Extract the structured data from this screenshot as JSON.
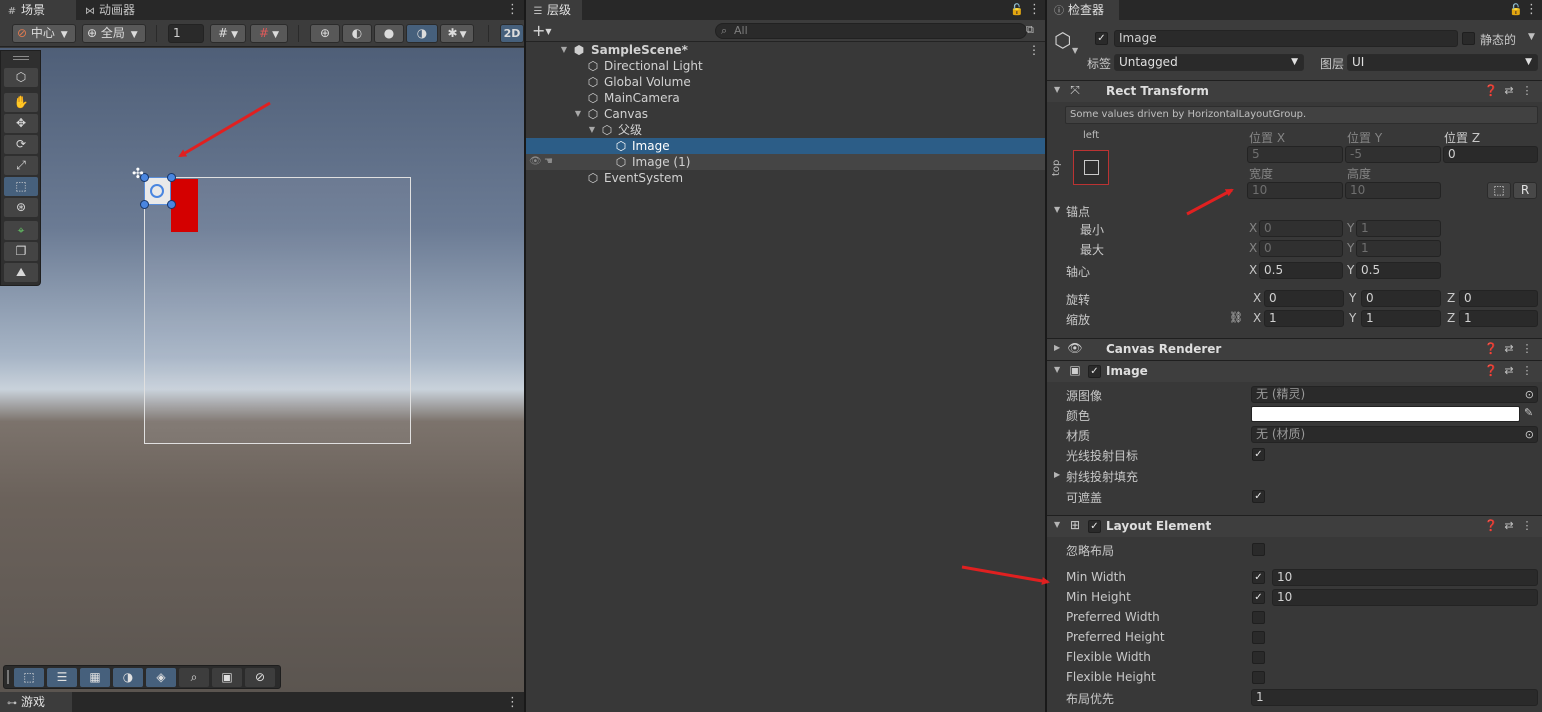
{
  "scene_panel": {
    "tab_scene": "场景",
    "tab_animator": "动画器",
    "pivot_mode": "中心",
    "space_mode": "全局",
    "grid_size": "1",
    "btn_2d": "2D"
  },
  "hierarchy": {
    "tab_label": "层级",
    "search_placeholder": "All",
    "items": [
      {
        "label": "SampleScene*"
      },
      {
        "label": "Directional Light"
      },
      {
        "label": "Global Volume"
      },
      {
        "label": "MainCamera"
      },
      {
        "label": "Canvas"
      },
      {
        "label": "父级"
      },
      {
        "label": "Image"
      },
      {
        "label": "Image (1)"
      },
      {
        "label": "EventSystem"
      }
    ]
  },
  "game_panel": {
    "tab_label": "游戏"
  },
  "inspector": {
    "tab_label": "检查器",
    "object_name": "Image",
    "static_label": "静态的",
    "tag_label": "标签",
    "tag_value": "Untagged",
    "layer_label": "图层",
    "layer_value": "UI",
    "rect_transform": {
      "title": "Rect Transform",
      "info": "Some values driven by HorizontalLayoutGroup.",
      "anchor_h": "left",
      "anchor_v": "top",
      "pos_x_label": "位置 X",
      "pos_y_label": "位置 Y",
      "pos_z_label": "位置 Z",
      "pos_x": "5",
      "pos_y": "-5",
      "pos_z": "0",
      "width_label": "宽度",
      "height_label": "高度",
      "width": "10",
      "height": "10",
      "r_button": "R",
      "anchors_label": "锚点",
      "min_label": "最小",
      "max_label": "最大",
      "anchor_min_x": "0",
      "anchor_min_y": "1",
      "anchor_max_x": "0",
      "anchor_max_y": "1",
      "pivot_label": "轴心",
      "pivot_x": "0.5",
      "pivot_y": "0.5",
      "rotation_label": "旋转",
      "rot_x": "0",
      "rot_y": "0",
      "rot_z": "0",
      "scale_label": "缩放",
      "scale_x": "1",
      "scale_y": "1",
      "scale_z": "1",
      "x": "X",
      "y": "Y",
      "z": "Z"
    },
    "canvas_renderer": {
      "title": "Canvas Renderer"
    },
    "image": {
      "title": "Image",
      "source_label": "源图像",
      "source_value": "无 (精灵)",
      "color_label": "颜色",
      "color_value": "#ffffff",
      "material_label": "材质",
      "material_value": "无 (材质)",
      "raycast_label": "光线投射目标",
      "raycast_padding_label": "射线投射填充",
      "maskable_label": "可遮盖"
    },
    "layout_element": {
      "title": "Layout Element",
      "ignore_layout_label": "忽略布局",
      "min_width_label": "Min Width",
      "min_width": "10",
      "min_height_label": "Min Height",
      "min_height": "10",
      "preferred_width_label": "Preferred Width",
      "preferred_height_label": "Preferred Height",
      "flexible_width_label": "Flexible Width",
      "flexible_height_label": "Flexible Height",
      "priority_label": "布局优先",
      "priority": "1"
    }
  },
  "colors": {
    "selection": "#2c5d87",
    "annotation_arrow": "#e02020",
    "image_red": "#d40000"
  }
}
